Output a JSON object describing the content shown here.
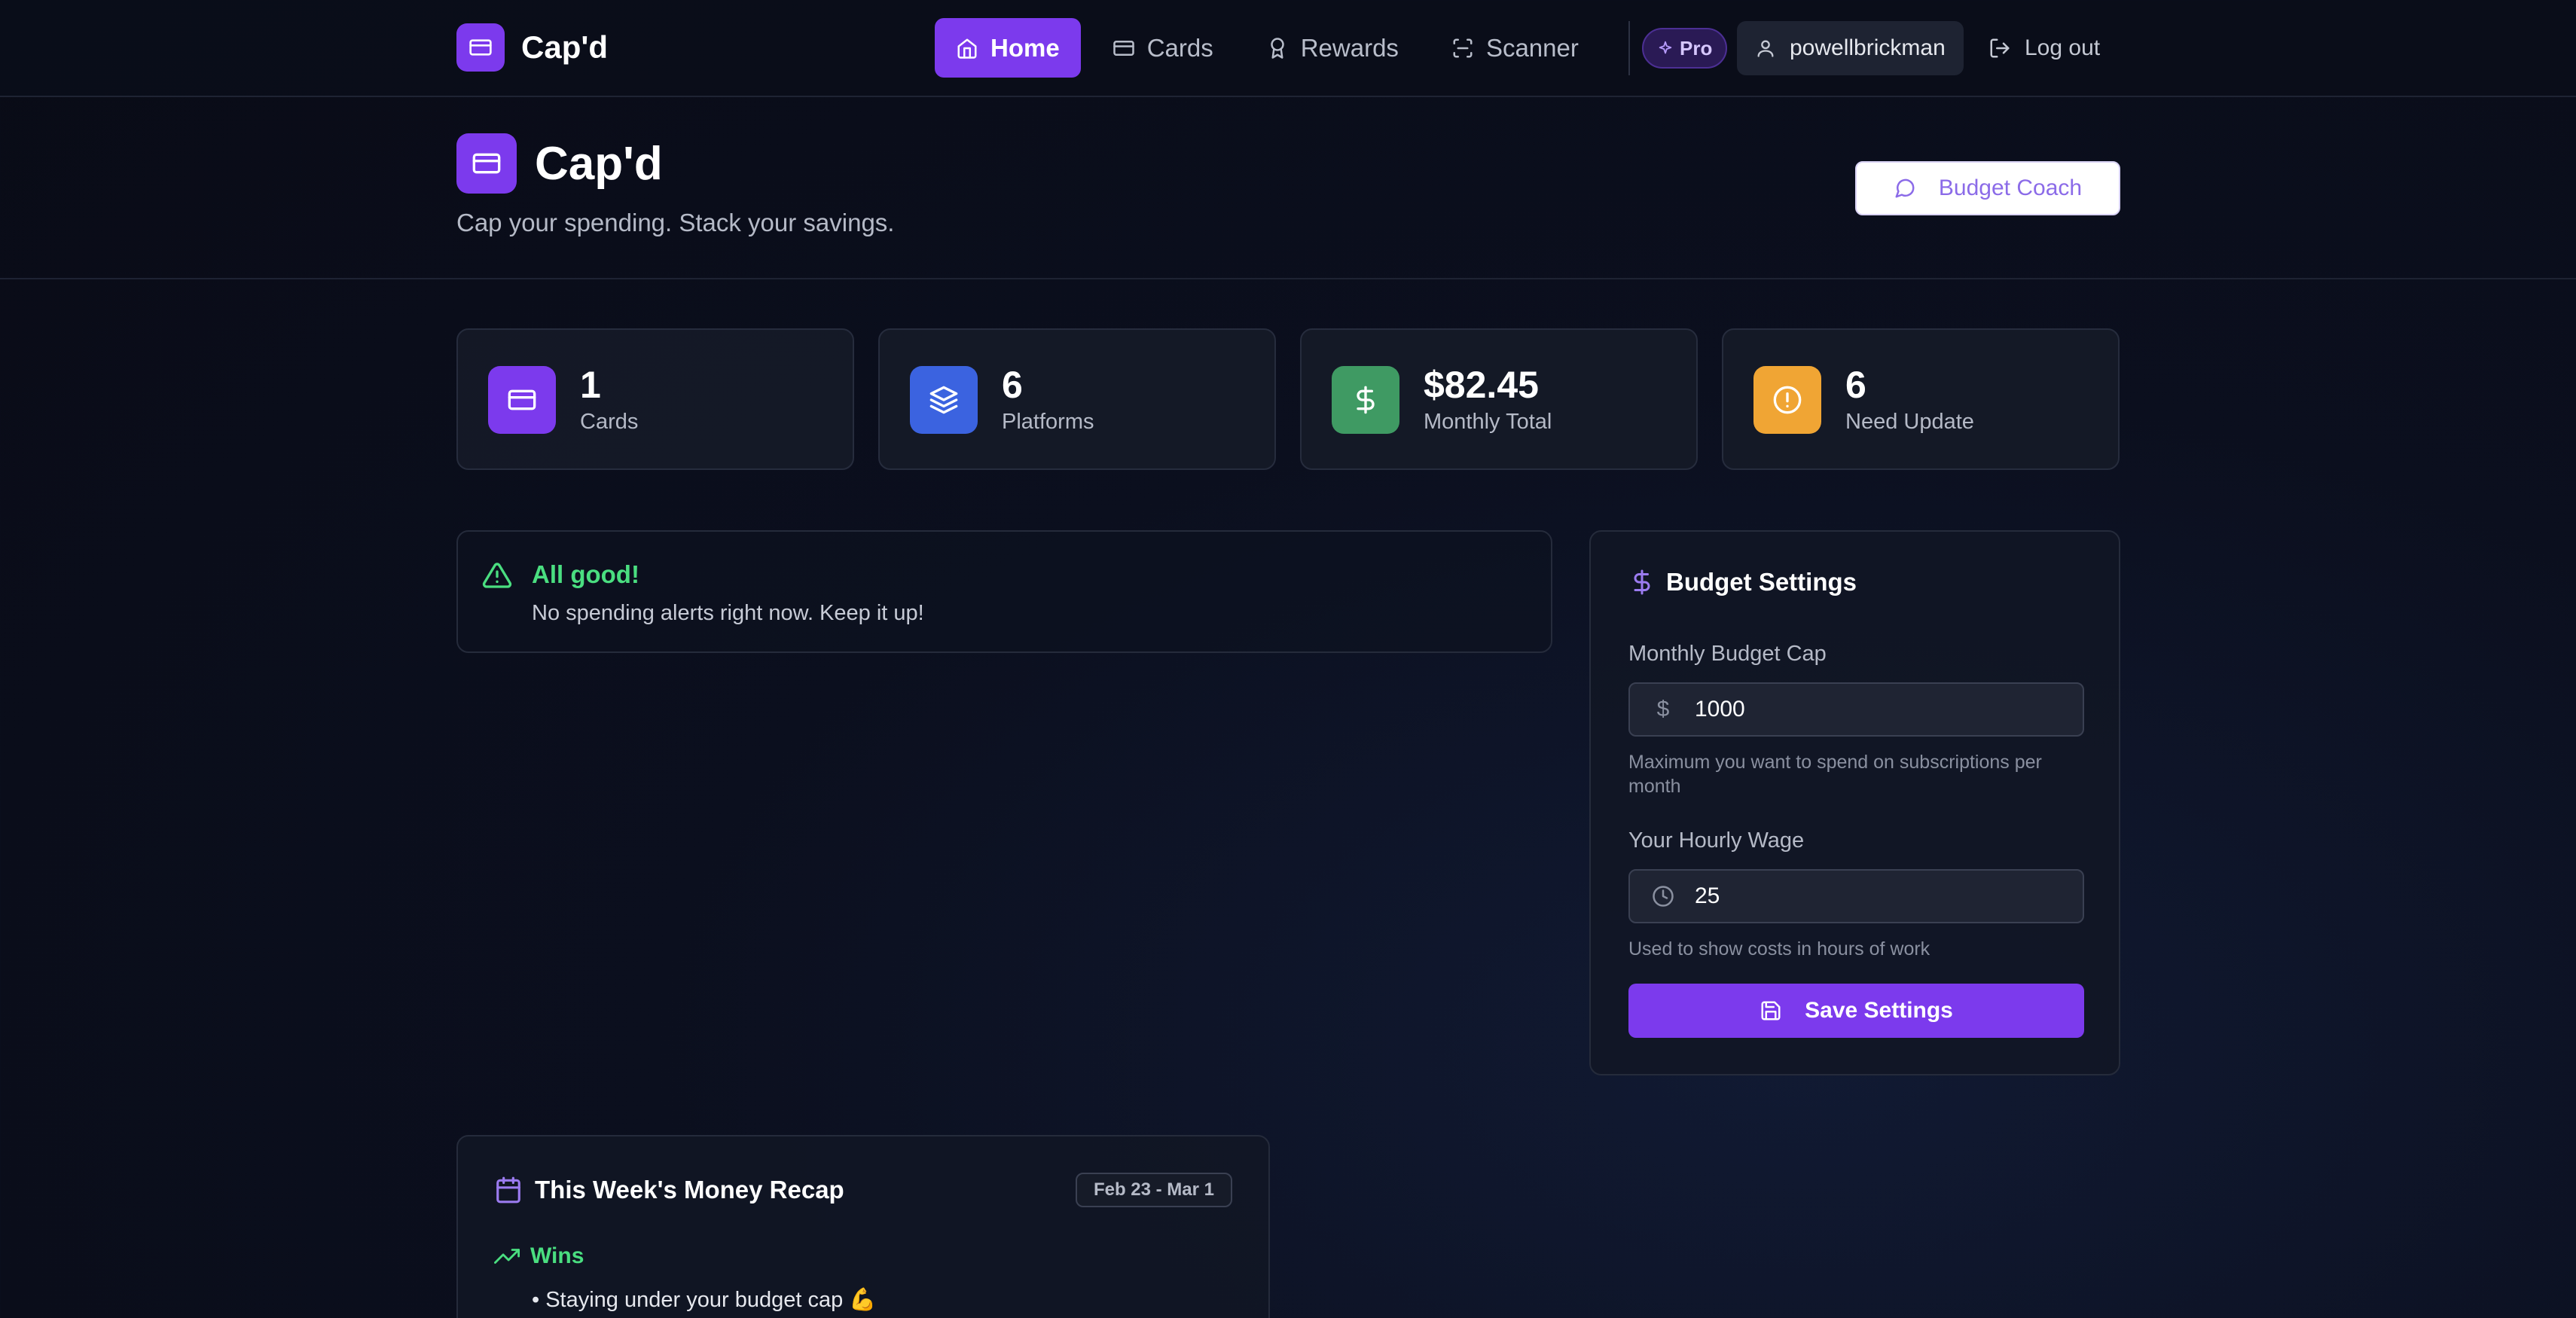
{
  "nav": {
    "brand": "Cap'd",
    "items": [
      {
        "label": "Home",
        "icon": "home-icon",
        "active": true
      },
      {
        "label": "Cards",
        "icon": "card-icon",
        "active": false
      },
      {
        "label": "Rewards",
        "icon": "award-icon",
        "active": false
      },
      {
        "label": "Scanner",
        "icon": "scan-icon",
        "active": false
      }
    ],
    "pro_badge": "Pro",
    "username": "powellbrickman",
    "logout": "Log out"
  },
  "header": {
    "title": "Cap'd",
    "tagline": "Cap your spending. Stack your savings.",
    "coach_button": "Budget Coach"
  },
  "stats": [
    {
      "value": "1",
      "label": "Cards",
      "icon": "card-icon",
      "color": "#7c3aed"
    },
    {
      "value": "6",
      "label": "Platforms",
      "icon": "layers-icon",
      "color": "#3b63e0"
    },
    {
      "value": "$82.45",
      "label": "Monthly Total",
      "icon": "dollar-icon",
      "color": "#3f9a63"
    },
    {
      "value": "6",
      "label": "Need Update",
      "icon": "alert-circle-icon",
      "color": "#f0a534"
    }
  ],
  "alert": {
    "title": "All good!",
    "text": "No spending alerts right now. Keep it up!"
  },
  "budget": {
    "title": "Budget Settings",
    "cap_label": "Monthly Budget Cap",
    "cap_prefix": "$",
    "cap_value": "1000",
    "cap_help": "Maximum you want to spend on subscriptions per month",
    "wage_label": "Your Hourly Wage",
    "wage_value": "25",
    "wage_help": "Used to show costs in hours of work",
    "save_button": "Save Settings"
  },
  "recap": {
    "title": "This Week's Money Recap",
    "date_range": "Feb 23 - Mar 1",
    "wins_title": "Wins",
    "wins_items": [
      "• Staying under your budget cap 💪"
    ]
  },
  "colors": {
    "accent": "#7c3aed",
    "success": "#4ade80",
    "background": "#0b0f1e"
  }
}
